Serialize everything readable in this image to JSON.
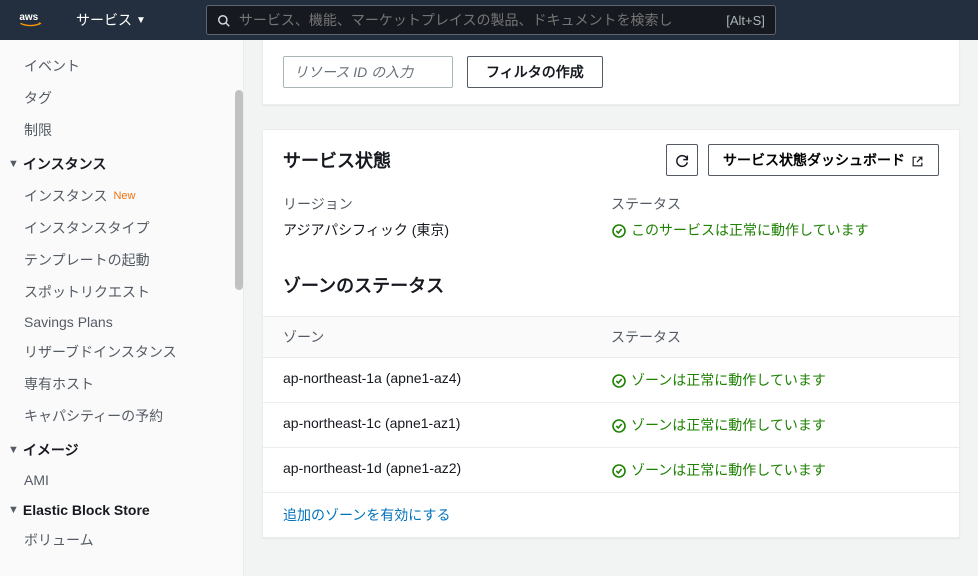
{
  "topbar": {
    "services_label": "サービス",
    "search_placeholder": "サービス、機能、マーケットプレイスの製品、ドキュメントを検索し",
    "search_hint": "[Alt+S]"
  },
  "sidebar": {
    "top_items": [
      {
        "label": "イベント"
      },
      {
        "label": "タグ"
      },
      {
        "label": "制限"
      }
    ],
    "sections": [
      {
        "label": "インスタンス",
        "items": [
          {
            "label": "インスタンス",
            "new": "New"
          },
          {
            "label": "インスタンスタイプ"
          },
          {
            "label": "テンプレートの起動"
          },
          {
            "label": "スポットリクエスト"
          },
          {
            "label": "Savings Plans"
          },
          {
            "label": "リザーブドインスタンス"
          },
          {
            "label": "専有ホスト"
          },
          {
            "label": "キャパシティーの予約"
          }
        ]
      },
      {
        "label": "イメージ",
        "items": [
          {
            "label": "AMI"
          }
        ]
      },
      {
        "label": "Elastic Block Store",
        "items": [
          {
            "label": "ボリューム"
          }
        ]
      }
    ]
  },
  "filter": {
    "input_placeholder": "リソース ID の入力",
    "button_label": "フィルタの作成"
  },
  "service_health": {
    "title": "サービス状態",
    "dashboard_label": "サービス状態ダッシュボード",
    "region_label": "リージョン",
    "region_value": "アジアパシフィック (東京)",
    "status_label": "ステータス",
    "status_value": "このサービスは正常に動作しています"
  },
  "zone_status": {
    "title": "ゾーンのステータス",
    "col_zone": "ゾーン",
    "col_status": "ステータス",
    "zones": [
      {
        "name": "ap-northeast-1a (apne1-az4)",
        "status": "ゾーンは正常に動作しています"
      },
      {
        "name": "ap-northeast-1c (apne1-az1)",
        "status": "ゾーンは正常に動作しています"
      },
      {
        "name": "ap-northeast-1d (apne1-az2)",
        "status": "ゾーンは正常に動作しています"
      }
    ],
    "footer_link": "追加のゾーンを有効にする"
  }
}
